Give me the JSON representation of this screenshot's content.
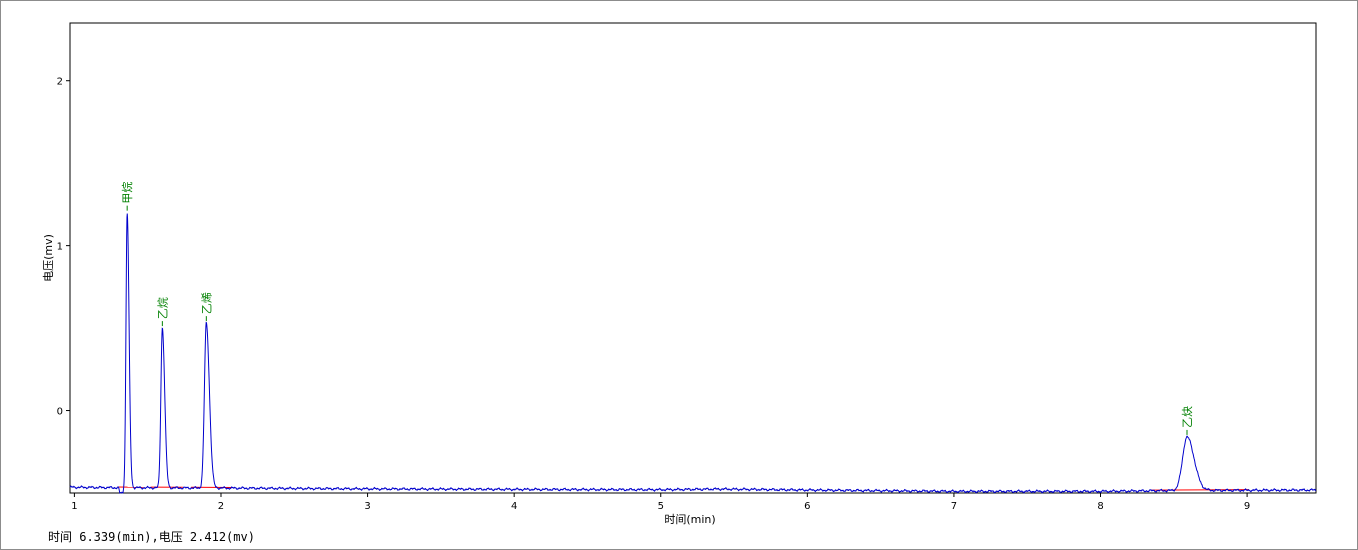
{
  "status_bar": {
    "text": "时间 6.339(min),电压 2.412(mv)"
  },
  "chart_data": {
    "type": "line",
    "title": "",
    "xlabel": "时间(min)",
    "ylabel": "电压(mv)",
    "xlim": [
      0.97,
      9.47
    ],
    "ylim": [
      -0.5,
      2.35
    ],
    "x_ticks": [
      "1",
      "2",
      "3",
      "4",
      "5",
      "6",
      "7",
      "8",
      "9"
    ],
    "y_ticks": [
      "2",
      "1",
      "0"
    ],
    "grid": false,
    "colors": {
      "signal": "#0000cc",
      "baseline": "#ff0000",
      "peak_label": "#008000",
      "axis": "#000000"
    },
    "baseline_level": -0.47,
    "baseline_points": [
      [
        0.97,
        -0.465
      ],
      [
        1.3,
        -0.468
      ],
      [
        1.31,
        -0.5
      ],
      [
        1.33,
        -0.5
      ],
      [
        1.34,
        -0.468
      ],
      [
        2.0,
        -0.47
      ],
      [
        3.0,
        -0.475
      ],
      [
        4.0,
        -0.478
      ],
      [
        5.0,
        -0.48
      ],
      [
        5.4,
        -0.476
      ],
      [
        6.0,
        -0.482
      ],
      [
        7.0,
        -0.49
      ],
      [
        8.0,
        -0.49
      ],
      [
        8.5,
        -0.485
      ],
      [
        9.47,
        -0.482
      ]
    ],
    "peaks": [
      {
        "name": "甲烷",
        "rt": 1.36,
        "height": 1.2,
        "width": 0.008
      },
      {
        "name": "乙烷",
        "rt": 1.6,
        "height": 0.5,
        "width": 0.01
      },
      {
        "name": "乙烯",
        "rt": 1.9,
        "height": 0.53,
        "width": 0.013
      },
      {
        "name": "乙炔",
        "rt": 8.59,
        "height": -0.16,
        "width": 0.03
      }
    ]
  }
}
